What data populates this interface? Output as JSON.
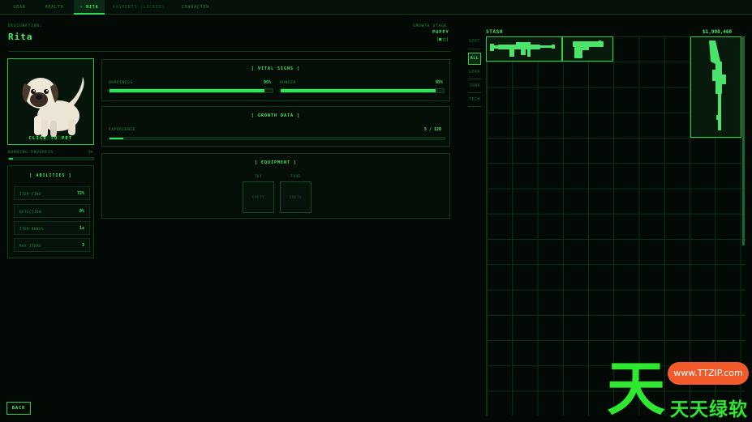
{
  "tabs": [
    {
      "label": "GEAR"
    },
    {
      "label": "HEALTH"
    },
    {
      "label": "› RITA"
    },
    {
      "label": "AUGMENTS (LOCKED)"
    },
    {
      "label": "CHARACTER"
    }
  ],
  "pet": {
    "designation_label": "DESIGNATION:",
    "name": "Rita",
    "growth_stage_label": "GROWTH STAGE",
    "growth_stage_value": "PUPPY",
    "growth_stage_pips": "[■□□]",
    "click_label": "CLICK TO PET",
    "bonding_label": "BONDING PROGRESS",
    "bonding_value": "5%",
    "bonding_progress": 0.05
  },
  "abilities": {
    "title": "[ ABILITIES ]",
    "items": [
      {
        "name": "ITEM FIND",
        "value": "72%"
      },
      {
        "name": "DETECTION",
        "value": "8%"
      },
      {
        "name": "ITEM BONUS",
        "value": "1x"
      },
      {
        "name": "MAX ITEMS",
        "value": "3"
      }
    ]
  },
  "vitals": {
    "title": "[ VITAL SIGNS ]",
    "happiness": {
      "label": "HAPPINESS",
      "value": "95%",
      "fraction": 0.95
    },
    "hunger": {
      "label": "HUNGER",
      "value": "95%",
      "fraction": 0.95
    }
  },
  "growth": {
    "title": "[ GROWTH DATA ]",
    "experience": {
      "label": "EXPERIENCE",
      "value": "5 / 120",
      "fraction": 0.042
    }
  },
  "equipment": {
    "title": "[ EQUIPMENT ]",
    "slots": [
      {
        "label": "TOY",
        "empty": "EMPTY"
      },
      {
        "label": "FOOD",
        "empty": "EMPTY"
      }
    ]
  },
  "sort": {
    "label": "SORT",
    "options": [
      {
        "label": "ALL"
      },
      {
        "label": "GEAR"
      },
      {
        "label": "JUNK"
      },
      {
        "label": "TECH"
      }
    ]
  },
  "stash": {
    "title": "STASH",
    "money": "$1,998,460",
    "items": [
      {
        "icon": "smg-icon"
      },
      {
        "icon": "pistol-icon"
      },
      {
        "icon": "rifle-icon"
      }
    ]
  },
  "back_label": "BACK",
  "watermark": {
    "big": "天",
    "pill": "www.TTZIP.com",
    "sub": "天天绿软"
  },
  "colors": {
    "accent": "#2ecc4a",
    "background": "#030a05"
  }
}
